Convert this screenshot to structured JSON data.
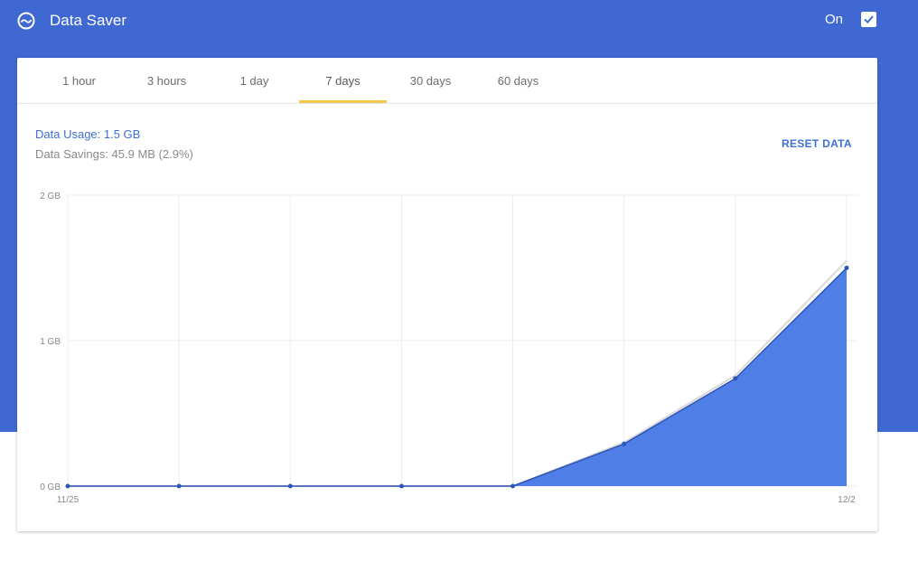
{
  "header": {
    "title": "Data Saver",
    "icon": "data-saver-icon",
    "toggle_label": "On",
    "toggle_checked": true
  },
  "colors": {
    "header_bg": "#3f68d2",
    "accent": "#3d6fd6",
    "area_fill": "#4f7fe6",
    "line": "#2d55b8",
    "tab_indicator": "#f2c84b"
  },
  "tabs": [
    {
      "label": "1 hour"
    },
    {
      "label": "3 hours"
    },
    {
      "label": "1 day"
    },
    {
      "label": "7 days",
      "active": true
    },
    {
      "label": "30 days"
    },
    {
      "label": "60 days"
    }
  ],
  "summary": {
    "usage": "Data Usage: 1.5 GB",
    "savings": "Data Savings: 45.9 MB (2.9%)",
    "reset_label": "RESET DATA"
  },
  "chart_data": {
    "type": "area",
    "y_ticks": [
      "0 GB",
      "1 GB",
      "2 GB"
    ],
    "ylim": [
      0,
      2
    ],
    "x_tick_labels": {
      "first": "11/25",
      "last": "12/2"
    },
    "x": [
      "11/25",
      "11/26",
      "11/27",
      "11/28",
      "11/29",
      "11/30",
      "12/1",
      "12/2"
    ],
    "series": [
      {
        "key": "usage",
        "values": [
          0,
          0,
          0,
          0,
          0,
          0.29,
          0.74,
          1.5
        ]
      },
      {
        "key": "original",
        "values": [
          0,
          0,
          0,
          0,
          0,
          0.3,
          0.76,
          1.55
        ]
      }
    ],
    "grid": true
  }
}
